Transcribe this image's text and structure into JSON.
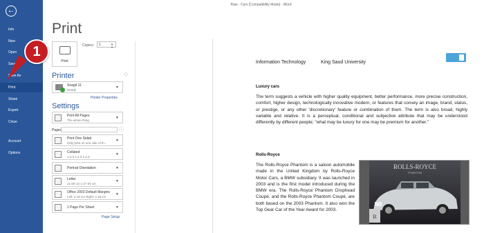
{
  "window_title": "Raw - Cars [Compatibility Mode] - Word",
  "nav": {
    "back_icon": "back-arrow-icon",
    "items": [
      {
        "label": "Info"
      },
      {
        "label": "New"
      },
      {
        "label": "Open"
      },
      {
        "label": "Save"
      },
      {
        "label": "Save As"
      },
      {
        "label": "Print",
        "active": true
      },
      {
        "label": "Share"
      },
      {
        "label": "Export"
      },
      {
        "label": "Close"
      },
      {
        "label": "Account"
      },
      {
        "label": "Options"
      }
    ]
  },
  "callout": {
    "number": "1",
    "color": "#c41e24"
  },
  "print": {
    "title": "Print",
    "print_button_label": "Print",
    "copies_label": "Copies:",
    "copies_value": "1"
  },
  "printer": {
    "heading": "Printer",
    "name": "Snagit 11",
    "status": "Ready",
    "properties_link": "Printer Properties"
  },
  "settings": {
    "heading": "Settings",
    "options": [
      {
        "line1": "Print All Pages",
        "line2": "The whole thing"
      },
      {
        "line1": "Print One Sided",
        "line2": "Only print on one side of th..."
      },
      {
        "line1": "Collated",
        "line2": "1,2,3   1,2,3   1,2,3"
      },
      {
        "line1": "Portrait Orientation",
        "line2": ""
      },
      {
        "line1": "Letter",
        "line2": "21.59 cm x 27.94 cm"
      },
      {
        "line1": "Office 2003 Default Margins",
        "line2": "Left: 3.18 cm   Right: 3.18 cm"
      },
      {
        "line1": "1 Page Per Sheet",
        "line2": ""
      }
    ],
    "pages_label": "Pages:",
    "page_setup_link": "Page Setup"
  },
  "document": {
    "header_left": "Information Technology",
    "header_right": "King Saud University",
    "section1_heading": "Luxury cars",
    "section1_text": "The term suggests a vehicle with higher quality equipment, better performance, more precise construction, comfort, higher design, technologically innovative modern, or features that convey an image, brand, status, or prestige, or any other 'discretionary' feature or combination of them. The term is also broad, highly variable and relative. It is a perceptual, conditional and subjective attribute that may be understood differently by different people; \"what may be luxury for one may be premium for another.\"",
    "section2_heading": "Rolls-Royce",
    "section2_text": "The Rolls-Royce Phantom is a saloon automobile made in the United Kingdom by Rolls-Royce Motor Cars, a BMW subsidiary. It was launched in 2003 and is the first model introduced during the BMW era. The Rolls-Royce Phantom Drophead Coupé, and the Rolls-Royce Phantom Coupé, are both based on the 2003 Phantom. It also won the Top Gear Car of the Year Award for 2003.",
    "photo_caption": "ROLLS-ROYCE",
    "photo_subcaption": "PHANTOM"
  }
}
